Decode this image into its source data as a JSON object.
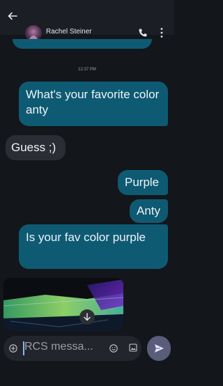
{
  "header": {
    "contact_name": "Rachel Steiner"
  },
  "conversation": {
    "timestamp": "12:37 PM",
    "messages": [
      {
        "direction": "outgoing",
        "text": "What's your favorite color anty"
      },
      {
        "direction": "incoming",
        "text": "Guess ;)"
      },
      {
        "direction": "outgoing",
        "text": "Purple"
      },
      {
        "direction": "outgoing",
        "text": "Anty"
      },
      {
        "direction": "outgoing",
        "text": "Is your fav color purple"
      }
    ]
  },
  "composer": {
    "placeholder": "RCS messa..."
  },
  "colors": {
    "outgoing_bubble": "#0e5a73",
    "incoming_bubble": "#2a2d33",
    "background": "#13161b",
    "send_button": "#5a5d79"
  },
  "icons": [
    "back-arrow-icon",
    "phone-icon",
    "more-vert-icon",
    "scroll-down-icon",
    "add-attachment-icon",
    "emoji-icon",
    "gallery-icon",
    "send-icon"
  ]
}
